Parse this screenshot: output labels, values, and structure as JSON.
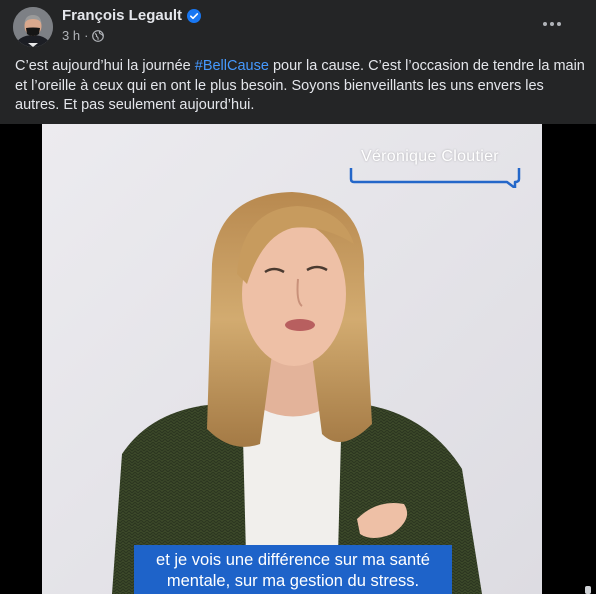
{
  "post": {
    "author": "François Legault",
    "time": "3 h",
    "separator": "·",
    "text_before": "C’est aujourd’hui la journée ",
    "hashtag": "#BellCause",
    "text_after": " pour la cause. C’est l’occasion de tendre la main et l’oreille à ceux qui en ont le plus besoin. Soyons bienveillants les uns envers les autres. Et pas seulement aujourd’hui."
  },
  "video": {
    "name_tag": "Véronique Cloutier",
    "subtitle_line1": "et je vois une différence sur ma santé",
    "subtitle_line2": "mentale, sur ma gestion du stress."
  },
  "icons": {
    "verified": "verified-badge-icon",
    "privacy": "globe-icon",
    "more": "more-options-icon"
  },
  "colors": {
    "background": "#242526",
    "hashtag": "#4599ff",
    "subtitle_bg": "#1e63c9",
    "verified": "#1877f2"
  }
}
